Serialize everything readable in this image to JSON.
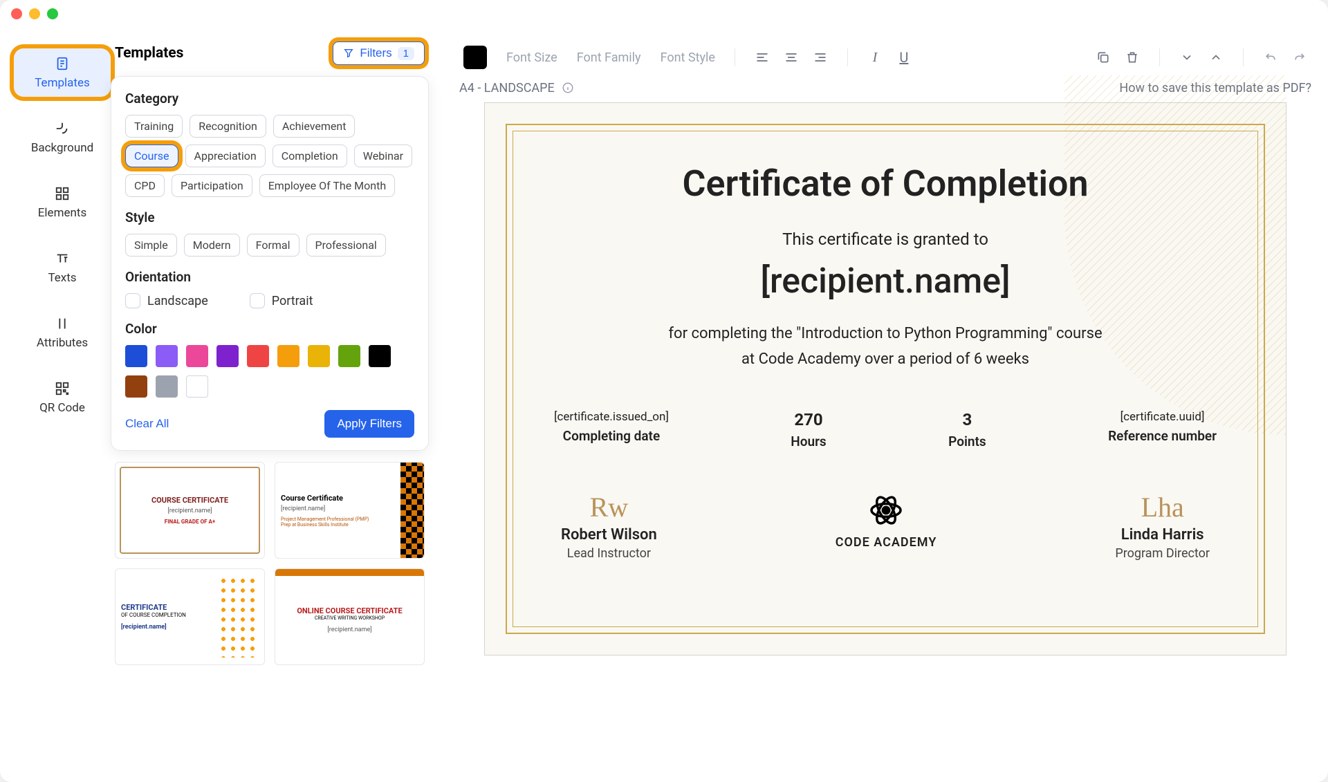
{
  "sidebar": {
    "items": [
      {
        "label": "Templates",
        "active": true
      },
      {
        "label": "Background"
      },
      {
        "label": "Elements"
      },
      {
        "label": "Texts"
      },
      {
        "label": "Attributes"
      },
      {
        "label": "QR Code"
      }
    ]
  },
  "panel": {
    "title": "Templates",
    "filters_label": "Filters",
    "filters_count": "1",
    "category_label": "Category",
    "categories": [
      "Training",
      "Recognition",
      "Achievement",
      "Course",
      "Appreciation",
      "Completion",
      "Webinar",
      "CPD",
      "Participation",
      "Employee Of The Month"
    ],
    "selected_category": "Course",
    "style_label": "Style",
    "styles": [
      "Simple",
      "Modern",
      "Formal",
      "Professional"
    ],
    "orientation_label": "Orientation",
    "orientation_landscape": "Landscape",
    "orientation_portrait": "Portrait",
    "color_label": "Color",
    "colors": [
      "#1d4ed8",
      "#8b5cf6",
      "#ec4899",
      "#7e22ce",
      "#ef4444",
      "#f59e0b",
      "#eab308",
      "#65a30d",
      "#000000",
      "#92400e",
      "#9ca3af",
      "#ffffff"
    ],
    "clear_label": "Clear All",
    "apply_label": "Apply Filters",
    "thumbs": [
      {
        "title": "COURSE CERTIFICATE",
        "sub": "[recipient.name]",
        "note": "FINAL GRADE OF A+"
      },
      {
        "title": "Course Certificate",
        "sub": "[recipient.name]",
        "note": "Project Management Professional (PMP) Prep at Business Skills Institute"
      },
      {
        "title": "CERTIFICATE",
        "sub1": "OF COURSE COMPLETION",
        "sub": "[recipient.name]"
      },
      {
        "title": "ONLINE COURSE CERTIFICATE",
        "sub1": "CREATIVE WRITING WORKSHOP",
        "sub": "[recipient.name]"
      }
    ]
  },
  "toolbar": {
    "font_size": "Font Size",
    "font_family": "Font Family",
    "font_style": "Font Style"
  },
  "canvas": {
    "format": "A4 - LANDSCAPE",
    "help": "How to save this template as PDF?"
  },
  "certificate": {
    "title": "Certificate of Completion",
    "granted": "This certificate is granted to",
    "recipient": "[recipient.name]",
    "desc1": "for completing the \"Introduction to Python Programming\" course",
    "desc2": "at Code Academy over a period of 6 weeks",
    "stats": [
      {
        "value": "[certificate.issued_on]",
        "label": "Completing date"
      },
      {
        "value": "270",
        "label": "Hours"
      },
      {
        "value": "3",
        "label": "Points"
      },
      {
        "value": "[certificate.uuid]",
        "label": "Reference number"
      }
    ],
    "sign1_name": "Robert Wilson",
    "sign1_role": "Lead Instructor",
    "org": "CODE ACADEMY",
    "sign2_name": "Linda Harris",
    "sign2_role": "Program Director"
  }
}
